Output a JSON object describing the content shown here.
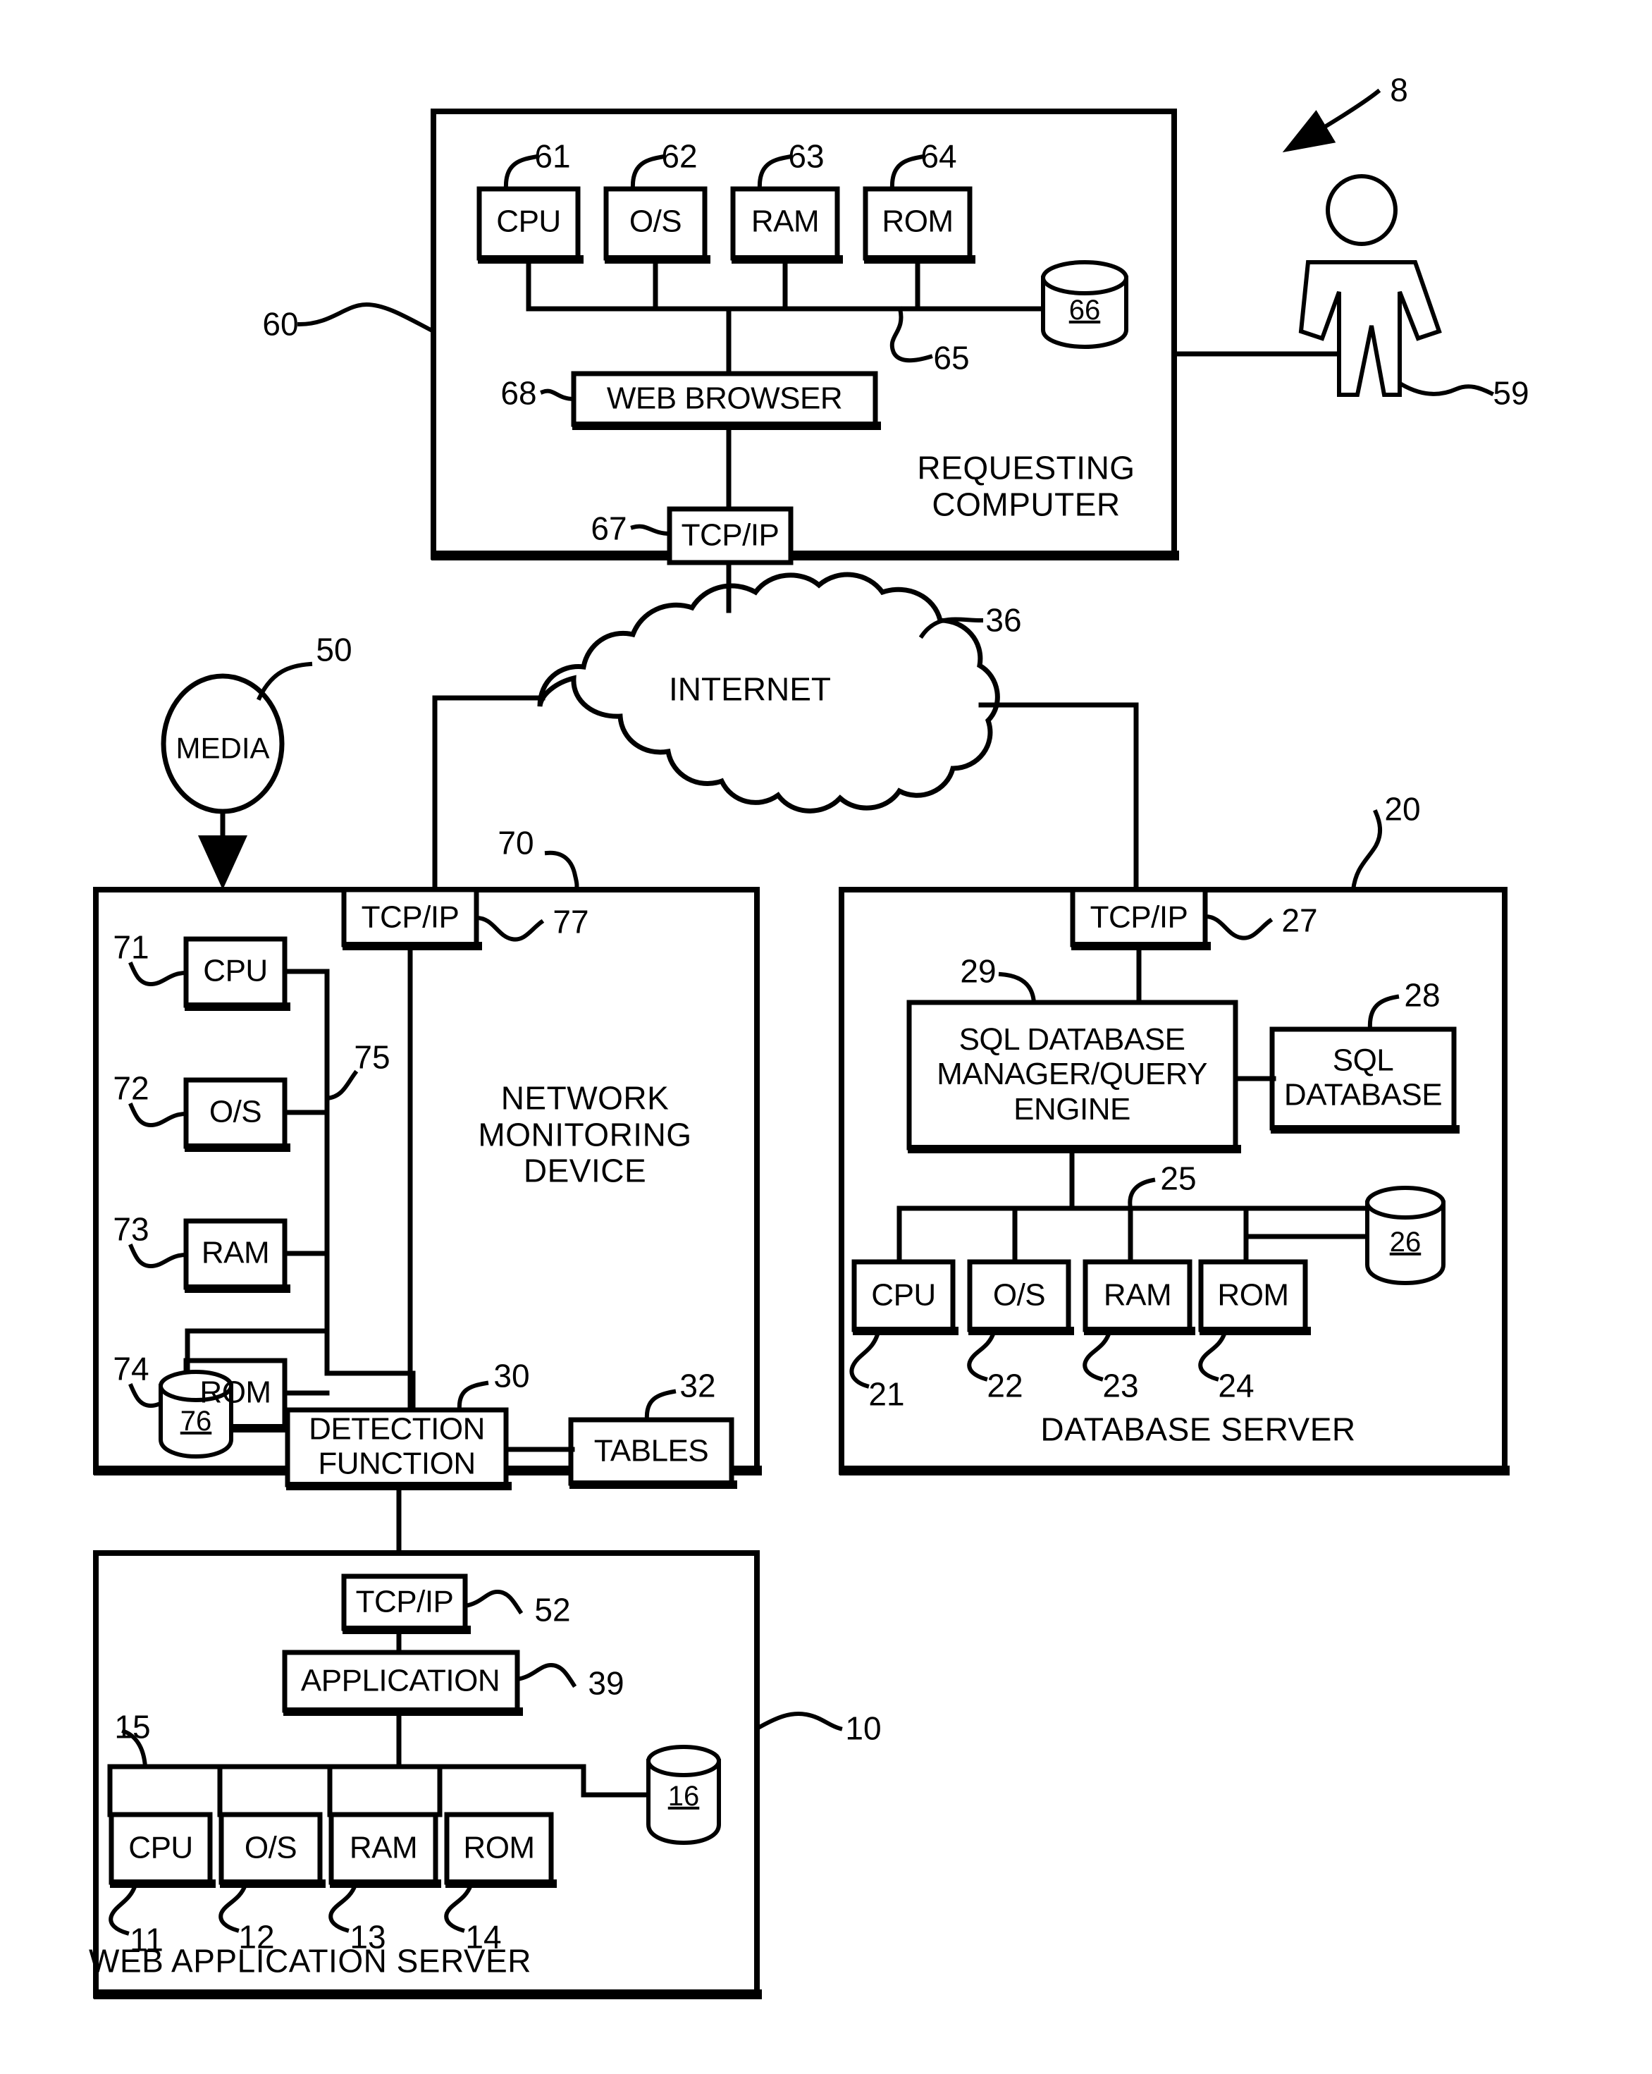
{
  "figure": {
    "ref_main": "8"
  },
  "requesting_computer": {
    "title": "REQUESTING\nCOMPUTER",
    "ref": "60",
    "components": [
      {
        "label": "CPU",
        "ref": "61"
      },
      {
        "label": "O/S",
        "ref": "62"
      },
      {
        "label": "RAM",
        "ref": "63"
      },
      {
        "label": "ROM",
        "ref": "64"
      }
    ],
    "bus_ref": "65",
    "storage": {
      "label": "66"
    },
    "browser": {
      "label": "WEB BROWSER",
      "ref": "68"
    },
    "network_stack": {
      "label": "TCP/IP",
      "ref": "67"
    }
  },
  "user": {
    "label_ref": "59"
  },
  "internet": {
    "label": "INTERNET",
    "ref": "36"
  },
  "media": {
    "label": "MEDIA",
    "ref": "50"
  },
  "network_monitoring_device": {
    "title": "NETWORK\nMONITORING\nDEVICE",
    "ref": "70",
    "components": [
      {
        "label": "CPU",
        "ref": "71"
      },
      {
        "label": "O/S",
        "ref": "72"
      },
      {
        "label": "RAM",
        "ref": "73"
      },
      {
        "label": "ROM",
        "ref": "74"
      }
    ],
    "bus_ref": "75",
    "storage": {
      "label": "76"
    },
    "network_stack": {
      "label": "TCP/IP",
      "ref": "77"
    },
    "detection_function": {
      "label": "DETECTION\nFUNCTION",
      "ref": "30"
    },
    "tables": {
      "label": "TABLES",
      "ref": "32"
    }
  },
  "database_server": {
    "title": "DATABASE SERVER",
    "ref": "20",
    "components": [
      {
        "label": "CPU",
        "ref": "21"
      },
      {
        "label": "O/S",
        "ref": "22"
      },
      {
        "label": "RAM",
        "ref": "23"
      },
      {
        "label": "ROM",
        "ref": "24"
      }
    ],
    "bus_ref": "25",
    "storage": {
      "label": "26"
    },
    "network_stack": {
      "label": "TCP/IP",
      "ref": "27"
    },
    "sql_database": {
      "label": "SQL\nDATABASE",
      "ref": "28"
    },
    "sql_manager": {
      "label": "SQL DATABASE\nMANAGER/QUERY\nENGINE",
      "ref": "29"
    }
  },
  "web_application_server": {
    "title": "WEB APPLICATION SERVER",
    "ref": "10",
    "components": [
      {
        "label": "CPU",
        "ref": "11"
      },
      {
        "label": "O/S",
        "ref": "12"
      },
      {
        "label": "RAM",
        "ref": "13"
      },
      {
        "label": "ROM",
        "ref": "14"
      }
    ],
    "bus_ref": "15",
    "storage": {
      "label": "16"
    },
    "network_stack": {
      "label": "TCP/IP",
      "ref": "52"
    },
    "application": {
      "label": "APPLICATION",
      "ref": "39"
    }
  },
  "colors": {
    "stroke": "#000000",
    "background": "#ffffff"
  }
}
